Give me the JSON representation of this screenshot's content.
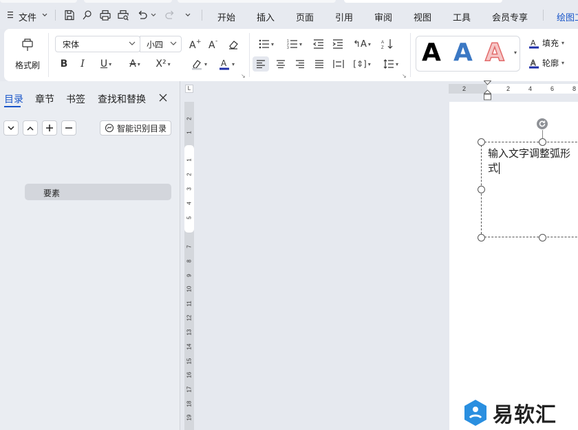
{
  "menubar": {
    "file_label": "文件",
    "tabs": [
      "开始",
      "插入",
      "页面",
      "引用",
      "审阅",
      "视图",
      "工具",
      "会员专享"
    ],
    "active_tab_partial": "绘图工"
  },
  "ribbon": {
    "format_painter_label": "格式刷",
    "font_name": "宋体",
    "font_size": "小四",
    "art_styles": [
      "A",
      "A",
      "A"
    ],
    "fill_label": "填充",
    "outline_label": "轮廓"
  },
  "nav": {
    "tabs": [
      "目录",
      "章节",
      "书签",
      "查找和替换"
    ],
    "active_tab": "目录",
    "smart_toc_label": "智能识别目录",
    "toc_items": [
      "要素"
    ]
  },
  "vruler": {
    "numbers": [
      "2",
      "1",
      "1",
      "2",
      "3",
      "4",
      "5",
      "7",
      "8",
      "9",
      "10",
      "11",
      "12",
      "13",
      "14",
      "15",
      "16",
      "17",
      "18",
      "19"
    ]
  },
  "hruler": {
    "numbers": [
      "2",
      "2",
      "4",
      "6",
      "8"
    ]
  },
  "document": {
    "textbox_text_line1": "输入文字调整弧形",
    "textbox_text_line2": "式"
  },
  "watermark": {
    "brand_text": "易软汇"
  },
  "colors": {
    "accent": "#1a56c9",
    "art_blue": "#3b78c4",
    "art_red": "#e26a6a",
    "font_color_bar": "#1f2fa8"
  }
}
